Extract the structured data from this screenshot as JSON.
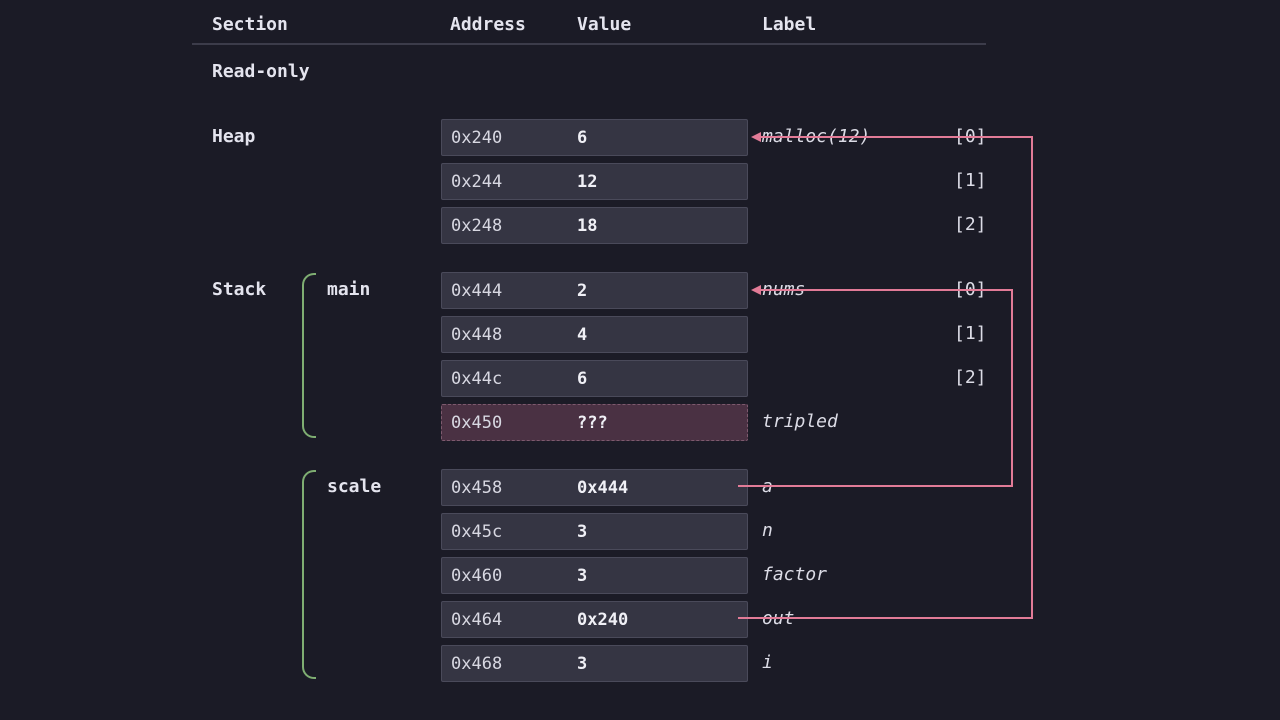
{
  "headers": {
    "section": "Section",
    "address": "Address",
    "value": "Value",
    "label": "Label"
  },
  "sections": {
    "readonly": "Read-only",
    "heap": "Heap",
    "stack": "Stack"
  },
  "frames": {
    "main": "main",
    "scale": "scale"
  },
  "heap": [
    {
      "address": "0x240",
      "value": "6",
      "label": "malloc(12)",
      "index": "[0]"
    },
    {
      "address": "0x244",
      "value": "12",
      "label": "",
      "index": "[1]"
    },
    {
      "address": "0x248",
      "value": "18",
      "label": "",
      "index": "[2]"
    }
  ],
  "main": [
    {
      "address": "0x444",
      "value": "2",
      "label": "nums",
      "index": "[0]"
    },
    {
      "address": "0x448",
      "value": "4",
      "label": "",
      "index": "[1]"
    },
    {
      "address": "0x44c",
      "value": "6",
      "label": "",
      "index": "[2]"
    },
    {
      "address": "0x450",
      "value": "???",
      "label": "tripled",
      "index": ""
    }
  ],
  "scale": [
    {
      "address": "0x458",
      "value": "0x444",
      "label": "a",
      "index": ""
    },
    {
      "address": "0x45c",
      "value": "3",
      "label": "n",
      "index": ""
    },
    {
      "address": "0x460",
      "value": "3",
      "label": "factor",
      "index": ""
    },
    {
      "address": "0x464",
      "value": "0x240",
      "label": "out",
      "index": ""
    },
    {
      "address": "0x468",
      "value": "3",
      "label": "i",
      "index": ""
    }
  ],
  "colors": {
    "pointer": "#e27b97",
    "frame_brace": "#7fae72",
    "cell": "#353543",
    "uninitialized_cell": "#4a3143"
  }
}
